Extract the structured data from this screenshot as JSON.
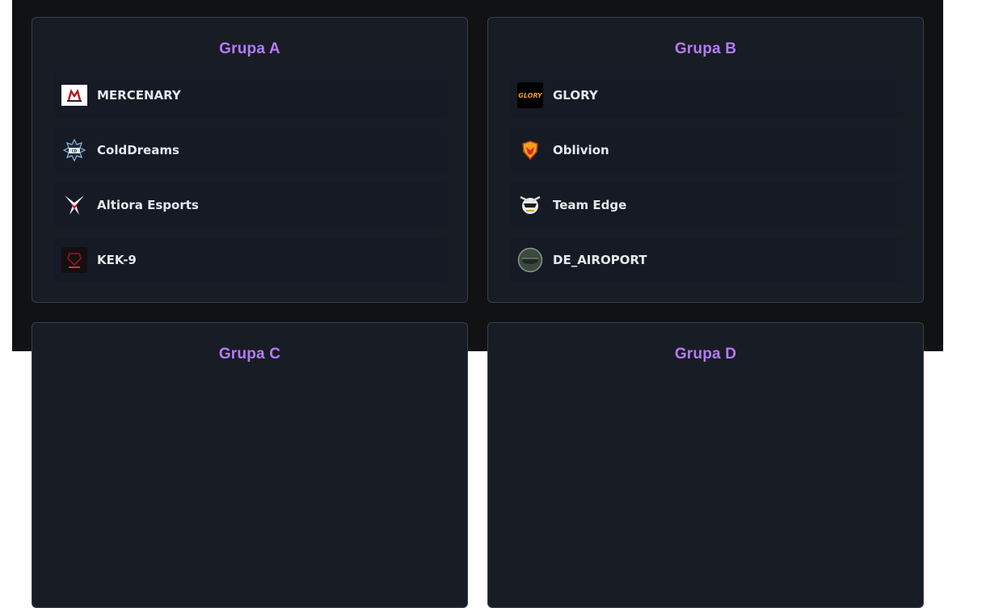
{
  "groups": [
    {
      "title": "Grupa A",
      "teams": [
        {
          "name": "MERCENARY",
          "logo": "mercenary-logo-icon"
        },
        {
          "name": "ColdDreams",
          "logo": "colddreams-logo-icon"
        },
        {
          "name": "Altiora Esports",
          "logo": "altiora-logo-icon"
        },
        {
          "name": "KEK-9",
          "logo": "kek9-logo-icon"
        }
      ]
    },
    {
      "title": "Grupa B",
      "teams": [
        {
          "name": "GLORY",
          "logo": "glory-logo-icon"
        },
        {
          "name": "Oblivion",
          "logo": "oblivion-logo-icon"
        },
        {
          "name": "Team Edge",
          "logo": "team-edge-logo-icon"
        },
        {
          "name": "DE_AIROPORT",
          "logo": "de-airoport-logo-icon"
        }
      ]
    },
    {
      "title": "Grupa C",
      "teams": []
    },
    {
      "title": "Grupa D",
      "teams": []
    }
  ],
  "colors": {
    "title_accent": "#b57bf5",
    "card_bg": "#181c24",
    "row_bg": "#151a25",
    "page_bg": "#111213"
  }
}
